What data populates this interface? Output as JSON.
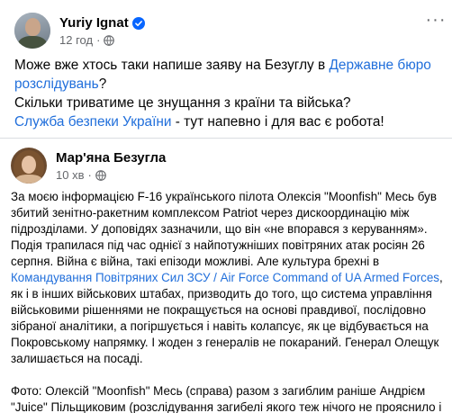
{
  "post": {
    "author": "Yuriy Ignat",
    "time": "12 год",
    "dot": "·",
    "more_label": "···",
    "line1_before": "Може вже хтось таки напише заяву на Безуглу в ",
    "line1_link": "Державне бюро розслідувань",
    "line1_after": "?",
    "line2": "Скільки триватиме це знущання з країни та війська?",
    "line3_link": "Служба безпеки України",
    "line3_after": " - тут напевно і для вас є робота!"
  },
  "shared": {
    "author": "Мар'яна Безугла",
    "time": "10 хв",
    "dot": "·",
    "para1_before": "За моєю інформацією F-16 українського пілота Олексія \"Moonfish\" Месь був збитий зенітно-ракетним комплексом Patriot через дискоординацію між підрозділами. У доповідях зазначили, що він «не впорався з керуванням». Подія трапилася під час однієї з найпотужніших повітряних атак росіян 26 серпня. Війна є війна, такі епізоди можливі. Але культура брехні в ",
    "para1_link": "Командування Повітряних Сил ЗСУ / Air Force Command of UA Armed Forces",
    "para1_after": ", як і в інших військових штабах, призводить до того, що система управління військовими рішеннями не покращується на основі правдивої, послідовно зібраної аналітики, а погіршується і навіть колапсує, як це відбувається на Покровському напрямку. І жоден з генералів не покараний. Генерал Олещук залишається на посаді.",
    "para2": "Фото: Олексій \"Moonfish\" Месь (справа) разом з загиблим раніше Андрієм \"Juice\" Пільщиковим (розслідування загибелі якого теж нічого не прояснило і ніхто не покараний)."
  },
  "icons": {
    "verified": "verified-badge-icon",
    "globe": "globe-icon",
    "more": "more-options-icon"
  },
  "colors": {
    "link": "#216fdb",
    "verified": "#0866ff",
    "meta": "#65676b",
    "text": "#050505"
  }
}
